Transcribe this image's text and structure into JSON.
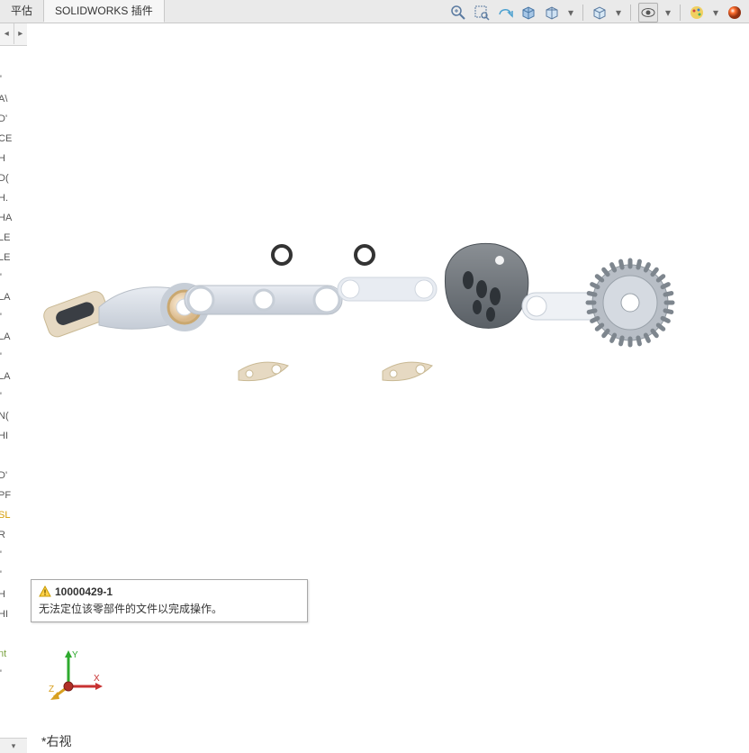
{
  "ribbon": {
    "tabs": [
      {
        "label": "平估",
        "active": false
      },
      {
        "label": "SOLIDWORKS 插件",
        "active": true
      }
    ]
  },
  "toolbar": {
    "icons": [
      "zoom-fit-icon",
      "zoom-window-icon",
      "eraser-icon",
      "box-icon",
      "multi-box-icon",
      "sep",
      "cube-icon",
      "sep",
      "eye-icon",
      "sep",
      "palette-icon",
      "colorball-icon"
    ]
  },
  "tree": {
    "items": [
      "\"",
      "A\\",
      "D'",
      "CE",
      "H",
      "D(",
      "H.",
      "HA",
      "LE",
      "LE",
      "\"",
      "LA",
      "\"",
      "LA",
      "\"",
      "LA",
      "\"",
      "N(",
      "HI",
      "",
      "D'",
      "PF",
      "SL",
      "R",
      "\"",
      "\"",
      "H",
      "HI",
      "",
      "nt",
      "\""
    ]
  },
  "warning": {
    "title": "10000429-1",
    "message": "无法定位该零部件的文件以完成操作。"
  },
  "triad": {
    "x": "X",
    "y": "Y",
    "z": "Z"
  },
  "viewLabel": "*右视"
}
